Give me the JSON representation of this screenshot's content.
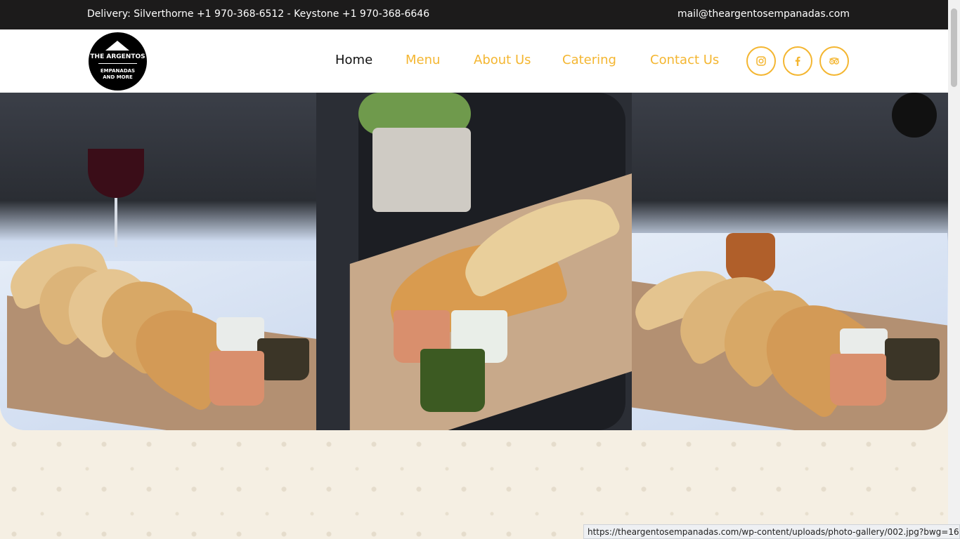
{
  "topbar": {
    "delivery": "Delivery: Silverthorne +1 970-368-6512 - Keystone +1 970-368-6646",
    "email": "mail@theargentosempanadas.com"
  },
  "logo": {
    "name": "THE ARGENTOS",
    "line1": "EMPANADAS",
    "line2": "AND MORE"
  },
  "nav": {
    "items": [
      "Home",
      "Menu",
      "About Us",
      "Catering",
      "Contact Us"
    ],
    "active": "Home"
  },
  "social": [
    "instagram-icon",
    "facebook-icon",
    "tripadvisor-icon"
  ],
  "status_url": "https://theargentosempanadas.com/wp-content/uploads/photo-gallery/002.jpg?bwg=1668523287",
  "colors": {
    "accent": "#f4b631",
    "topbar": "#1c1b1b",
    "background": "#f5efe3"
  }
}
